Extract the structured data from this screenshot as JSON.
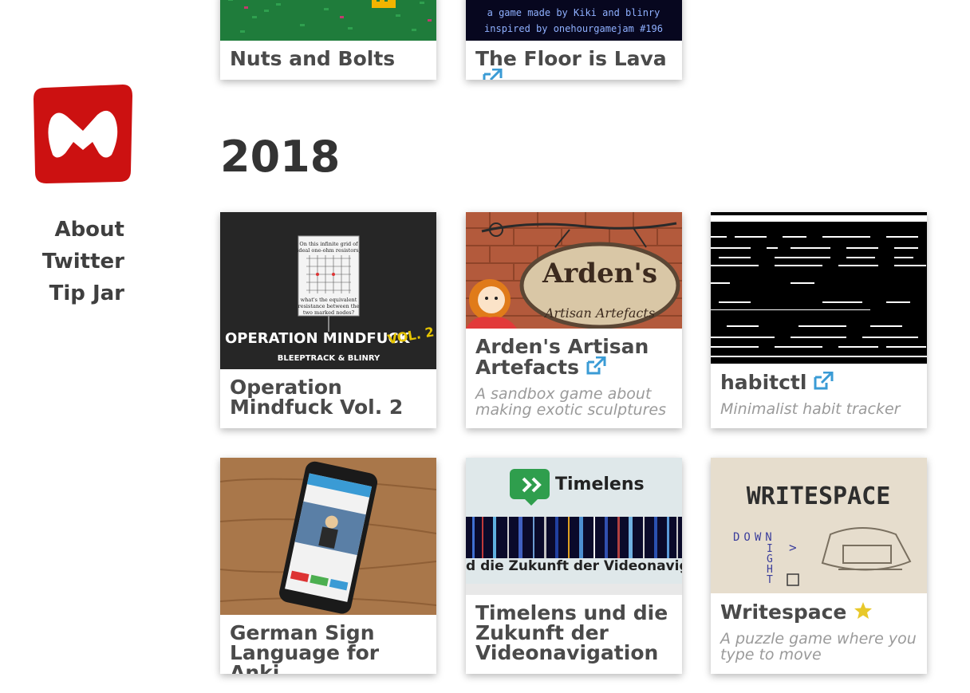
{
  "sidebar": {
    "logo_color": "#cc1111",
    "nav": [
      {
        "label": "About"
      },
      {
        "label": "Twitter"
      },
      {
        "label": "Tip Jar"
      }
    ]
  },
  "sections": [
    {
      "year": "",
      "cards": [
        {
          "title": "Nuts and Bolts",
          "external": false,
          "description": ""
        },
        {
          "title": "The Floor is Lava",
          "external": true,
          "description": "",
          "image_text": [
            "a game made by Kiki and blinry",
            "inspired by onehourgamejam #196"
          ]
        }
      ]
    },
    {
      "year": "2018",
      "cards": [
        {
          "title": "Operation Mindfuck Vol. 2",
          "external": false,
          "description": "",
          "image_text": [
            "OPERATION MINDFUCK",
            "VOL. 2",
            "BLEEPTRACK & BLINRY",
            "On this infinite grid of",
            "ideal one-ohm resistors,",
            "what's the equivalent",
            "resistance between the",
            "two marked nodes?"
          ]
        },
        {
          "title": "Arden's Artisan Artefacts",
          "external": true,
          "description": "A sandbox game about making exotic sculptures",
          "image_text": [
            "Arden's",
            "Artisan Artefacts"
          ]
        },
        {
          "title": "habitctl",
          "external": true,
          "description": "Minimalist habit tracker"
        },
        {
          "title": "German Sign Language for Anki",
          "external": false,
          "description": ""
        },
        {
          "title": "Timelens und die Zukunft der Videonavigation",
          "external": false,
          "description": "",
          "image_text": [
            "Timelens",
            "d die Zukunft der Videonavigati"
          ]
        },
        {
          "title": "Writespace",
          "external": false,
          "starred": true,
          "description": "A puzzle game where you type to move",
          "image_text": [
            "WRITESPACE",
            "DOWN",
            "RIGHT",
            ">"
          ]
        }
      ]
    }
  ],
  "colors": {
    "accent": "#3a9bd5",
    "star": "#e8c82a",
    "text": "#4a4a4a",
    "muted": "#9a9a9a"
  }
}
